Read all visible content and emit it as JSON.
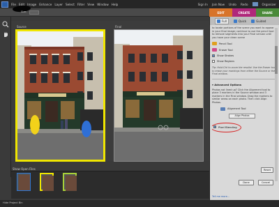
{
  "menubar": {
    "items": [
      "File",
      "Edit",
      "Image",
      "Enhance",
      "Layer",
      "Select",
      "Filter",
      "View",
      "Window",
      "Help"
    ],
    "right": {
      "signin": "Sign In",
      "join": "Join Now",
      "undo": "Undo",
      "redo": "Redo",
      "organizer": "Organizer"
    }
  },
  "optbar": {
    "size_label": "Size:",
    "size_value": ""
  },
  "modetabs": {
    "edit": "EDIT",
    "create": "CREATE",
    "share": "SHARE"
  },
  "workarea": {
    "source_label": "Source",
    "final_label": "Final"
  },
  "panel": {
    "tabs": {
      "full": "Full",
      "quick": "Quick",
      "guided": "Guided"
    },
    "intro": "to locate portions of the scene you want to appear in your final image; continue to use the pencil tool to remove segments into your Final version until you have your clean scene",
    "pencil_tool": "Pencil Tool",
    "eraser_tool": "Eraser Tool",
    "show_strokes": "Show Strokes",
    "show_regions": "Show Regions",
    "tip": "Tip: Hold Ctrl to zoom the results! Use the Eraser tool to erase your markings from either the Source or the Final window.",
    "advanced_title": "Advanced Options",
    "advanced_text": "Photos not lined up? Click the Alignment tool to place 3 markers in the Source window and 3 markers in the Final window. Drag the markers to similar areas on each photo. Then click Align Photos.",
    "alignment_tool": "Alignment Tool",
    "align_photos": "Align Photos",
    "pixel_blending": "Pixel Blending",
    "reset": "Reset",
    "done": "Done",
    "cancel": "Cancel",
    "tell_me_more": "Tell me more..."
  },
  "bin": {
    "label": "Show Open Files"
  },
  "status": {
    "text": "Hide Project Bin"
  },
  "colors": {
    "source_border": "#f0e600",
    "edit_tab": "#d8742a",
    "create_tab": "#b0277b",
    "share_tab": "#4a8a3a",
    "circle": "#d62020"
  }
}
